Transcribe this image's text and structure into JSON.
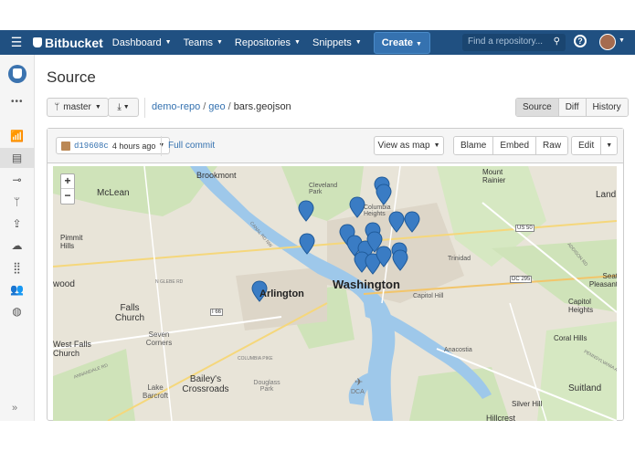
{
  "nav": {
    "dashboard": "Dashboard",
    "teams": "Teams",
    "repositories": "Repositories",
    "snippets": "Snippets",
    "create": "Create",
    "search_placeholder": "Find a repository...",
    "brand": "Bitbucket"
  },
  "page": {
    "title": "Source",
    "branch": "master",
    "breadcrumb": {
      "repo": "demo-repo",
      "folder": "geo",
      "file": "bars.geojson"
    },
    "view_tabs": [
      "Source",
      "Diff",
      "History"
    ]
  },
  "file": {
    "commit_hash": "d19608c",
    "commit_time": "4 hours ago",
    "full_commit": "Full commit",
    "view_mode": "View as map",
    "actions": [
      "Blame",
      "Embed",
      "Raw"
    ],
    "edit": "Edit"
  },
  "map": {
    "zoom_in": "+",
    "zoom_out": "−",
    "labels": {
      "brookmont": "Brookmont",
      "mclean": "McLean",
      "cleveland_park": "Cleveland Park",
      "columbia_heights": "Columbia Heights",
      "mount_rainier": "Mount Rainier",
      "land": "Land",
      "pimmit_hills": "Pimmit Hills",
      "wood": "wood",
      "arlington": "Arlington",
      "washington": "Washington",
      "capitol_hill": "Capitol Hill",
      "trinidad": "Trinidad",
      "seat_pleasant": "Seat Pleasant",
      "capitol_heights": "Capitol Heights",
      "falls_church": "Falls Church",
      "seven_corners": "Seven Corners",
      "west_falls_church": "West Falls Church",
      "anacostia": "Anacostia",
      "coral_hills": "Coral Hills",
      "baileys_crossroads": "Bailey's Crossroads",
      "lake_barcroft": "Lake Barcroft",
      "douglass_park": "Douglass Park",
      "dca": "DCA",
      "suitland": "Suitland",
      "silver_hill": "Silver Hill",
      "hillcrest": "Hillcrest",
      "us50": "US 50",
      "dc295": "DC 295",
      "i66": "I 66",
      "n_glebe": "N GLEBE RD",
      "columbia_pike": "COLUMBIA PIKE",
      "canal_rd": "CANAL RD NW",
      "annandale": "ANNANDALE RD",
      "addison": "ADDISON RD",
      "penn_ave": "PENNSYLVANIA AVE"
    }
  },
  "colors": {
    "topbar": "#205081",
    "accent": "#3572b0",
    "pin": "#3a7cc4"
  }
}
